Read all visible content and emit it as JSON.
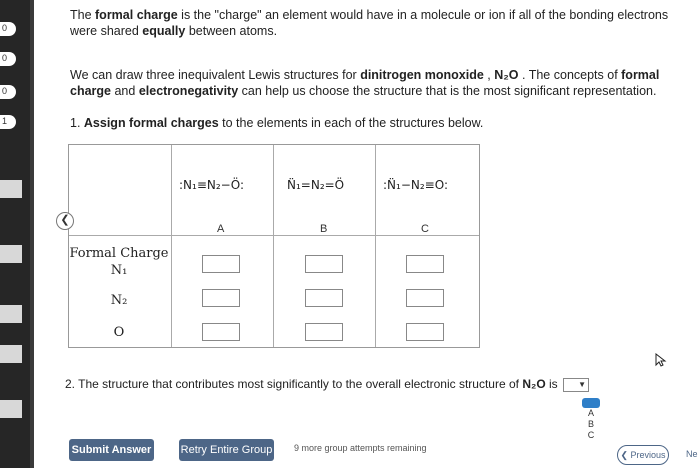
{
  "intro": {
    "p1_a": "The ",
    "p1_b": "formal charge",
    "p1_c": " is the \"charge\" an element would have in a molecule or ion if all of the bonding electrons were shared ",
    "p1_d": "equally",
    "p1_e": " between atoms.",
    "p2_a": "We can draw three inequivalent Lewis structures for ",
    "p2_b": "dinitrogen monoxide",
    "p2_c": " , ",
    "p2_d": "N₂O",
    "p2_e": " . The concepts of ",
    "p2_f": "formal charge",
    "p2_g": " and ",
    "p2_h": "electronegativity",
    "p2_i": " can help us choose the structure that is the most significant representation."
  },
  "question1": {
    "num": "1. ",
    "bold": "Assign formal charges",
    "rest": " to the elements in each of the structures below."
  },
  "structures": [
    {
      "label": "A",
      "formula": ":N₁≡N₂−Ö:"
    },
    {
      "label": "B",
      "formula": "N̈₁=N₂=Ö"
    },
    {
      "label": "C",
      "formula": ":N̈₁−N₂≡O:"
    }
  ],
  "table": {
    "header": "Formal Charge",
    "rows": [
      "N₁",
      "N₂",
      "O"
    ]
  },
  "question2": {
    "text_a": "2. The structure that contributes most significantly to the overall electronic structure of ",
    "text_b": "N₂O",
    "text_c": " is",
    "options": [
      "A",
      "B",
      "C"
    ]
  },
  "footer": {
    "submit": "Submit Answer",
    "retry": "Retry Entire Group",
    "remaining": "9 more group attempts remaining",
    "previous": "Previous",
    "next": "Ne"
  }
}
